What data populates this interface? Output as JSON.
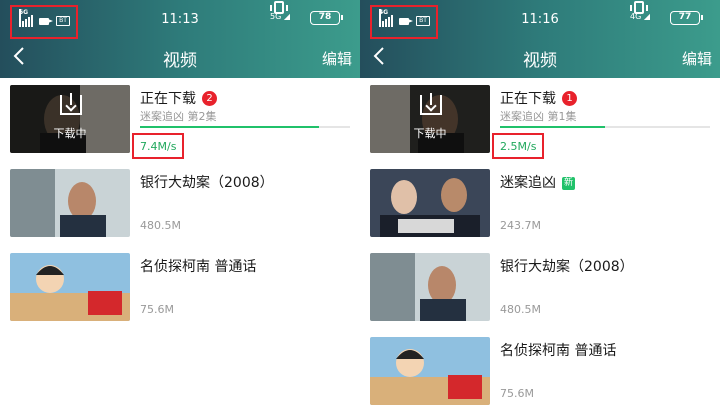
{
  "colors": {
    "header_gradient_start": "#244e5c",
    "header_gradient_end": "#3c9c8c",
    "badge": "#e8222c",
    "progress": "#20c16a",
    "speed": "#20a85c",
    "highlight": "#e8222c"
  },
  "panels": [
    {
      "status": {
        "network": "5G",
        "sim": "BT",
        "time": "11:13",
        "wifi": "5G",
        "battery": "78"
      },
      "header": {
        "back": "back-icon",
        "title": "视频",
        "edit": "编辑"
      },
      "downloading": {
        "overlay": "下载中",
        "name": "正在下载",
        "badge": "2",
        "subtitle": "迷案追凶 第2集",
        "progress": 0.85,
        "speed": "7.4M/s"
      },
      "items": [
        {
          "name": "银行大劫案（2008）",
          "size": "480.5M"
        },
        {
          "name": "名侦探柯南 普通话",
          "size": "75.6M"
        }
      ]
    },
    {
      "status": {
        "network": "4G",
        "sim": "BT",
        "time": "11:16",
        "wifi": "4G",
        "battery": "77"
      },
      "header": {
        "back": "back-icon",
        "title": "视频",
        "edit": "编辑"
      },
      "downloading": {
        "overlay": "下载中",
        "name": "正在下载",
        "badge": "1",
        "subtitle": "迷案追凶 第1集",
        "progress": 0.5,
        "speed": "2.5M/s"
      },
      "items": [
        {
          "name": "迷案追凶",
          "tag": "新",
          "size": "243.7M"
        },
        {
          "name": "银行大劫案（2008）",
          "size": "480.5M"
        },
        {
          "name": "名侦探柯南 普通话",
          "size": "75.6M"
        }
      ]
    }
  ]
}
